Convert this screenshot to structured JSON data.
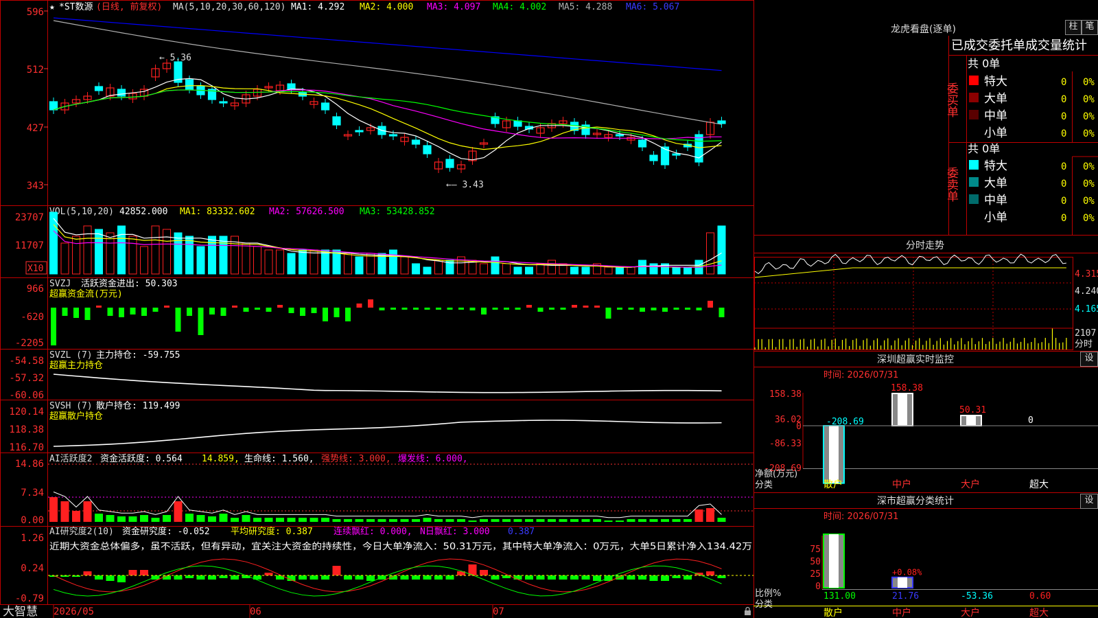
{
  "colors": {
    "up": "#ff2020",
    "down": "#00ffff",
    "grid": "#c00000",
    "bg": "#000000",
    "ma1": "#ffffff",
    "ma2": "#ffff00",
    "ma3": "#ff00ff",
    "ma4": "#00ff00",
    "ma5": "#b0b0b0",
    "ma6": "#0000ff",
    "axis": "#ff3030"
  },
  "title_bar": {
    "icon": "star-icon",
    "stock": "*ST数源",
    "mode": "(日线, 前复权)",
    "ma_label": "MA(5,10,20,30,60,120)",
    "ma1": "MA1: 4.292",
    "ma2": "MA2: 4.000",
    "ma3": "MA3: 4.097",
    "ma4": "MA4: 4.002",
    "ma5": "MA5: 4.288",
    "ma6": "MA6: 5.067"
  },
  "price_axis": [
    "596",
    "512",
    "427",
    "343"
  ],
  "price_notes": {
    "high": "5.36",
    "low": "3.43"
  },
  "vol_bar": {
    "label": "VOL(5,10,20)",
    "value": "42852.000",
    "ma1": "MA1: 83332.602",
    "ma2": "MA2: 57626.500",
    "ma3": "MA3: 53428.852"
  },
  "vol_axis": [
    "23707",
    "11707"
  ],
  "vol_unit": "X10",
  "svzj": {
    "label": "SVZJ",
    "name": "活跃资金进出: 50.303",
    "sub": "超赢资金流(万元)",
    "axis": [
      "966",
      "-620",
      "-2205"
    ]
  },
  "svzl": {
    "label": "SVZL (7)",
    "name": "主力持仓: -59.755",
    "sub": "超赢主力持仓",
    "axis": [
      "-54.58",
      "-57.32",
      "-60.06"
    ]
  },
  "svsh": {
    "label": "SVSH (7)",
    "name": "散户持仓: 119.499",
    "sub": "超赢散户持仓",
    "axis": [
      "120.14",
      "118.38",
      "116.70"
    ]
  },
  "ai2": {
    "label": "AI活跃度2",
    "a": "资金活跃度: 0.564",
    "b": "14.859,",
    "c": "生命线: 1.560,",
    "d": "强势线: 3.000,",
    "e": "爆发线: 6.000,",
    "axis": [
      "14.86",
      "7.34",
      "0.00"
    ]
  },
  "ai_research": {
    "label": "AI研究度2(10)",
    "a": "资金研究度: -0.052",
    "b": "平均研究度: 0.387",
    "c": "连续飘红: 0.000,",
    "d": "N日飘红: 3.000",
    "e": "0.387",
    "note": "近期大资金总体偏多，虽不活跃，但有异动，宜关注大资金的持续性，今日大单净流入：50.31万元，其中特大单净流入：0万元，大单5日累计净入134.42万",
    "axis": [
      "1.26",
      "0.24",
      "-0.79"
    ]
  },
  "date_axis": [
    "2026/05",
    "06",
    "07"
  ],
  "logo": "大智慧",
  "right": {
    "lhb_title": "龙虎看盘(逐单)",
    "btn_zhu": "柱",
    "btn_bi": "笔",
    "tabs_header": "已成交委托单成交量统计",
    "buy_label": "委买单",
    "sell_label": "委卖单",
    "buy_total": "共 0单",
    "sell_total": "共 0单",
    "buy_rows": [
      {
        "name": "特大",
        "n": "0",
        "p": "0%",
        "color": "#ff0000"
      },
      {
        "name": "大单",
        "n": "0",
        "p": "0%",
        "color": "#8b0000"
      },
      {
        "name": "中单",
        "n": "0",
        "p": "0%",
        "color": "#5a0000"
      },
      {
        "name": "小单",
        "n": "0",
        "p": "0%",
        "color": "#000000"
      }
    ],
    "sell_rows": [
      {
        "name": "特大",
        "n": "0",
        "p": "0%",
        "color": "#00ffff"
      },
      {
        "name": "大单",
        "n": "0",
        "p": "0%",
        "color": "#008b8b"
      },
      {
        "name": "中单",
        "n": "0",
        "p": "0%",
        "color": "#006b6b"
      },
      {
        "name": "小单",
        "n": "0",
        "p": "0%",
        "color": "#000000"
      }
    ],
    "fenshi_title": "分时走势",
    "fenshi_axis": [
      "4.315",
      "4.240",
      "4.165"
    ],
    "fenshi_vol": "2107",
    "fenshi_unit": "分时",
    "monitor_title": "深圳超赢实时监控",
    "btn_set": "设",
    "monitor_time": "时间: 2026/07/31",
    "monitor_axis": [
      "158.38",
      "36.02",
      "0",
      "-86.33",
      "-208.69"
    ],
    "monitor_bars": [
      {
        "cat": "散户",
        "value": -208.69,
        "label": "-208.69"
      },
      {
        "cat": "中户",
        "value": 158.38,
        "label": "158.38"
      },
      {
        "cat": "大户",
        "value": 50.31,
        "label": "50.31"
      },
      {
        "cat": "超大",
        "value": 0,
        "label": "0"
      }
    ],
    "monitor_ylab": "净额(万元)",
    "monitor_xlab": "分类",
    "cls_title": "深市超赢分类统计",
    "cls_time": "时间: 2026/07/31",
    "cls_axis": [
      "75",
      "50",
      "25",
      "0"
    ],
    "cls_bars": [
      {
        "cat": "散户",
        "value": 131.0,
        "label": "131.00",
        "pct": null
      },
      {
        "cat": "中户",
        "value": 21.76,
        "label": "21.76",
        "pct": "+0.08%"
      },
      {
        "cat": "大户",
        "value": -53.36,
        "label": "-53.36",
        "pct": null
      },
      {
        "cat": "超大",
        "value": 0.6,
        "label": "0.60",
        "pct": null
      }
    ],
    "cls_ylab": "比例%",
    "cls_xlab": "分类"
  }
}
